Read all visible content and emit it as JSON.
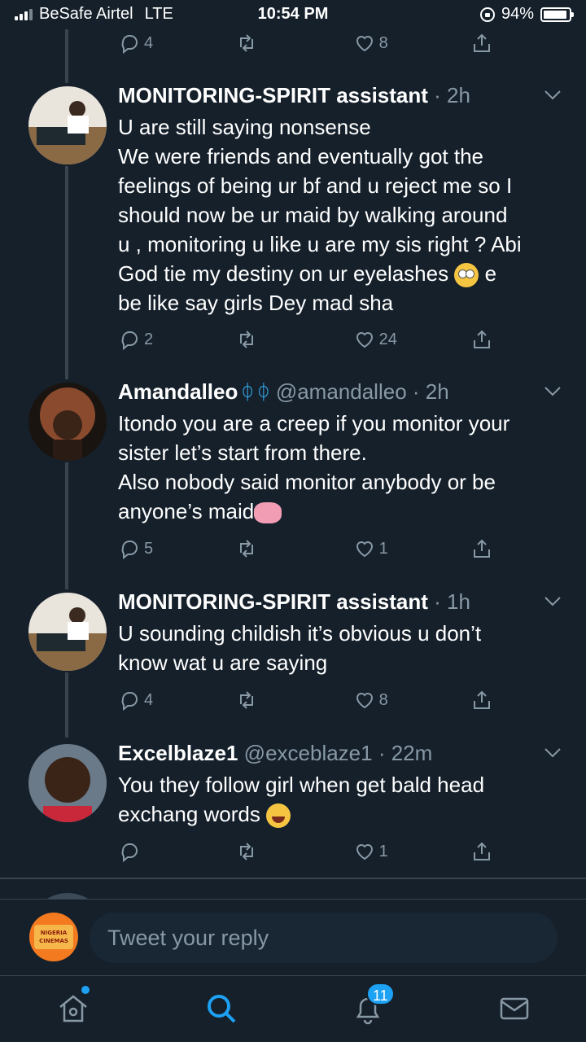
{
  "status_bar": {
    "carrier": "BeSafe Airtel",
    "network": "LTE",
    "time": "10:54 PM",
    "battery": "94%",
    "battery_level": 0.94
  },
  "top_actions": {
    "reply_count": "4",
    "like_count": "8"
  },
  "tweets": [
    {
      "name": "MONITORING-SPIRIT assistant",
      "handle": "",
      "time": "2h",
      "lines": [
        "U are still saying nonsense",
        "We were friends and eventually got the",
        "feelings of being ur bf and u reject me so I",
        "should now be ur maid by walking around",
        "u , monitoring u like u are my sis right ? Abi",
        "God tie my destiny on ur eyelashes",
        "be like say girls Dey mad sha"
      ],
      "emoji_after_line_6": "e",
      "reply_count": "2",
      "like_count": "24"
    },
    {
      "name": "Amandalleo",
      "handle": "@amandalleo",
      "time": "2h",
      "lines": [
        "Itondo you are a creep if you monitor your",
        "sister let’s start from there.",
        "Also nobody said monitor anybody or be",
        "anyone’s maid"
      ],
      "reply_count": "5",
      "like_count": "1"
    },
    {
      "name": "MONITORING-SPIRIT assistant",
      "handle": "",
      "time": "1h",
      "lines": [
        "U sounding childish it’s obvious u don’t",
        "know wat u are saying"
      ],
      "reply_count": "4",
      "like_count": "8"
    },
    {
      "name": "Excelblaze1",
      "handle": "@exceblaze1",
      "time": "22m",
      "lines": [
        "You they follow girl when get bald head",
        "exchang words"
      ],
      "reply_count": "",
      "like_count": "1"
    }
  ],
  "reply_bar": {
    "placeholder": "Tweet your reply",
    "avatar_text": "NIGERIA CINEMAS"
  },
  "tab_bar": {
    "notifications_badge": "11"
  },
  "colors": {
    "background": "#15202b",
    "secondary_text": "#8899a6",
    "accent": "#1da1f2",
    "divider": "#38444d"
  }
}
